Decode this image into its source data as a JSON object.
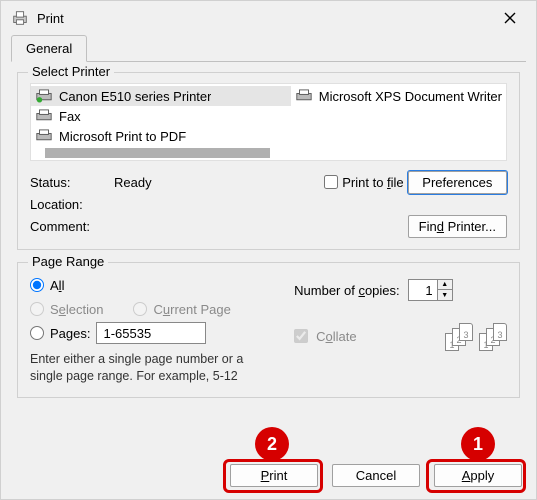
{
  "window": {
    "title": "Print"
  },
  "tabs": {
    "general": "General"
  },
  "select_printer": {
    "group_label": "Select Printer",
    "items": [
      "Canon E510 series Printer",
      "Fax",
      "Microsoft Print to PDF",
      "Microsoft XPS Document Writer"
    ]
  },
  "status_block": {
    "status_label": "Status:",
    "status_value": "Ready",
    "location_label": "Location:",
    "comment_label": "Comment:",
    "print_to_file": "Print to file",
    "preferences_btn": "Preferences",
    "find_printer_btn": "Find Printer..."
  },
  "page_range": {
    "group_label": "Page Range",
    "all": "All",
    "selection": "Selection",
    "current_page": "Current Page",
    "pages": "Pages:",
    "pages_value": "1-65535",
    "hint": "Enter either a single page number or a single page range.  For example, 5-12"
  },
  "copies": {
    "label": "Number of copies:",
    "value": "1",
    "collate": "Collate"
  },
  "buttons": {
    "print": "Print",
    "cancel": "Cancel",
    "apply": "Apply"
  },
  "annotations": {
    "one": "1",
    "two": "2"
  }
}
